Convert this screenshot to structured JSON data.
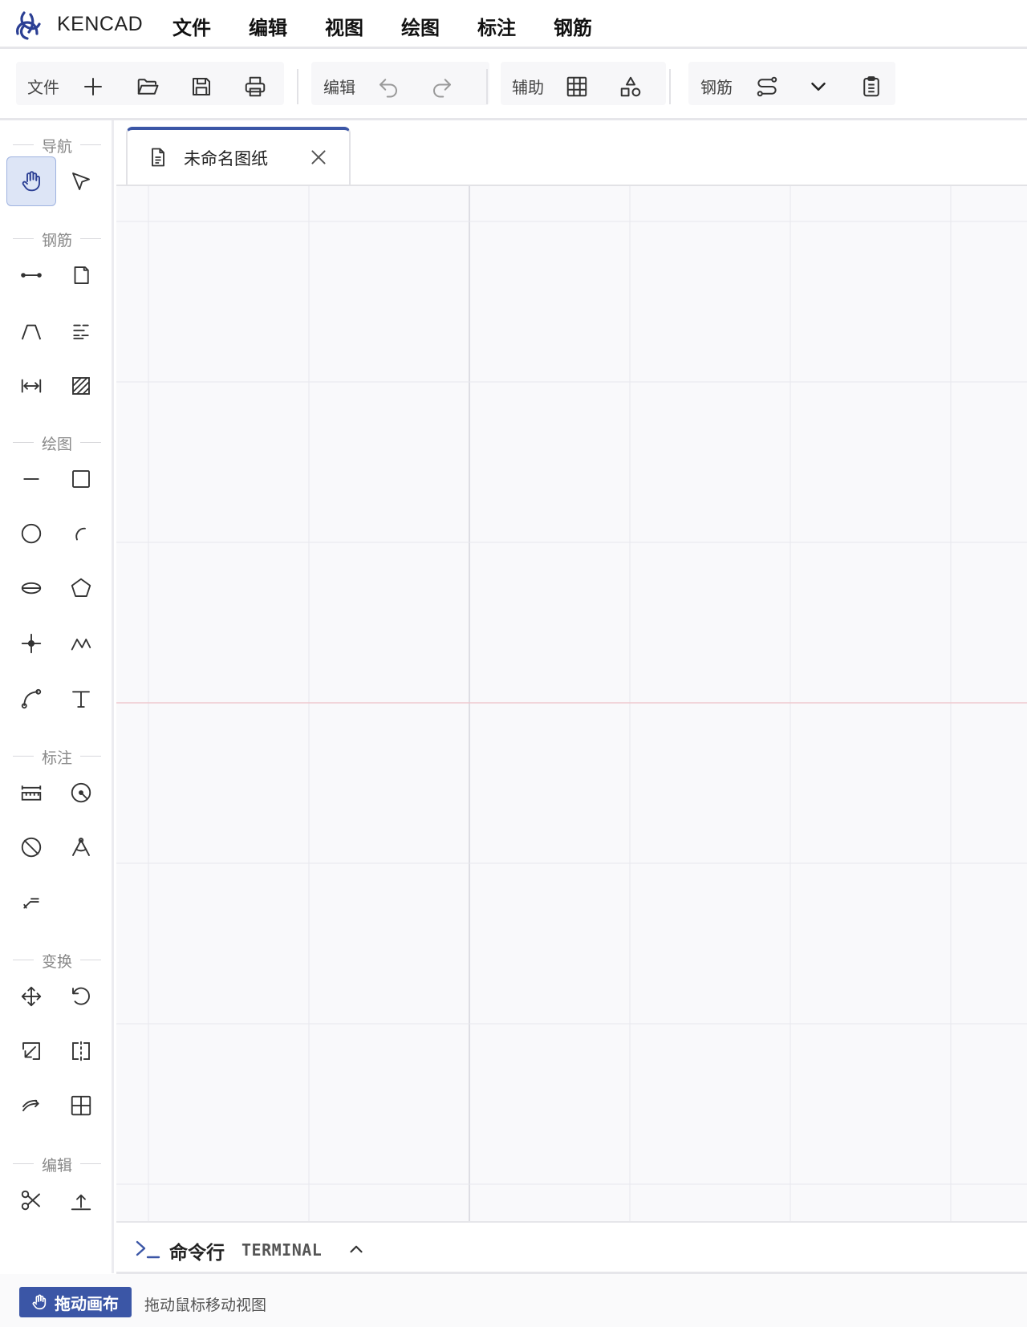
{
  "app": {
    "name": "KENCAD",
    "accent": "#3b56a6"
  },
  "menu": {
    "items": [
      "文件",
      "编辑",
      "视图",
      "绘图",
      "标注",
      "钢筋"
    ]
  },
  "toolbar": {
    "file_label": "文件",
    "edit_label": "编辑",
    "assist_label": "辅助",
    "rebar_label": "钢筋"
  },
  "sidebar": {
    "sections": {
      "nav": "导航",
      "rebar": "钢筋",
      "draw": "绘图",
      "dim": "标注",
      "transform": "变换",
      "edit": "编辑"
    },
    "active_tool": "pan-tool"
  },
  "document": {
    "tab_title": "未命名图纸"
  },
  "terminal": {
    "title": "命令行",
    "subtitle": "TERMINAL"
  },
  "status": {
    "mode_label": "拖动画布",
    "message": "拖动鼠标移动视图"
  }
}
